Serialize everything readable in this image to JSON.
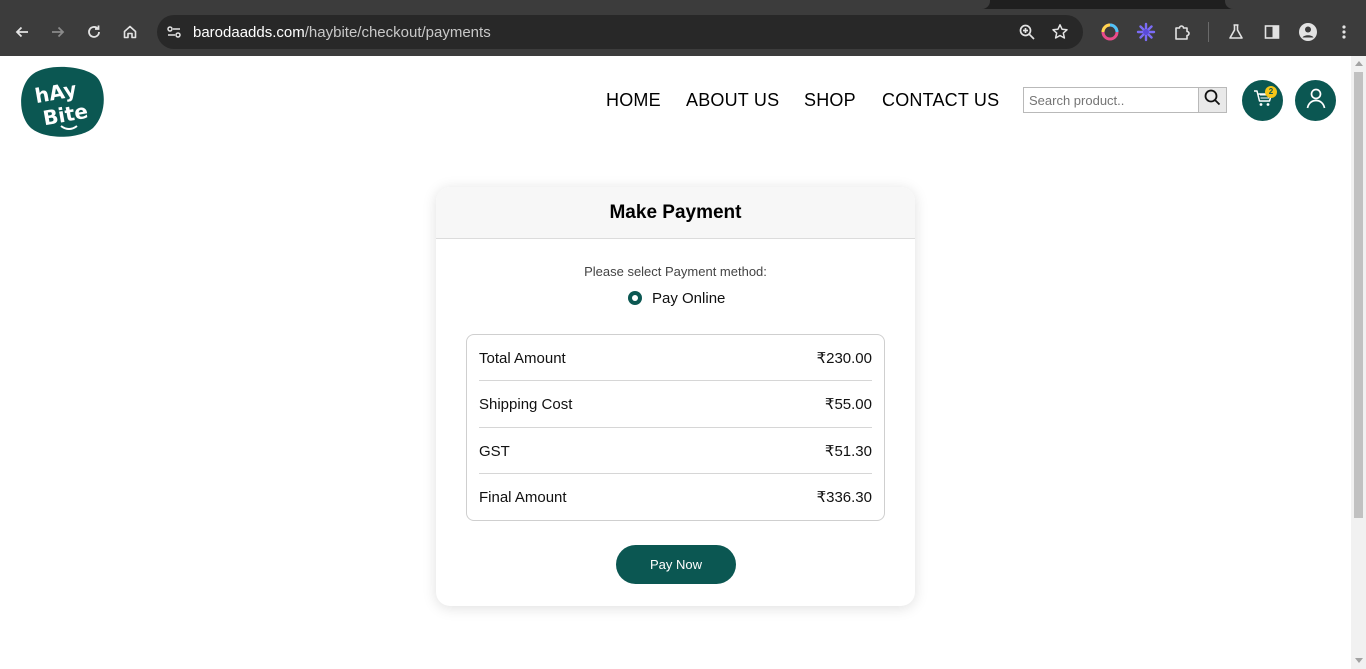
{
  "browser": {
    "url_host": "barodaadds.com",
    "url_path": "/haybite/checkout/payments",
    "icons": [
      "back-arrow-icon",
      "forward-arrow-icon",
      "reload-icon",
      "home-icon",
      "site-info-icon",
      "zoom-icon",
      "bookmark-star-icon",
      "color-extension-icon",
      "sparkle-extension-icon",
      "puzzle-extensions-icon",
      "labs-flask-icon",
      "side-panel-icon",
      "profile-icon",
      "menu-dots-icon"
    ]
  },
  "site": {
    "logo_alt": "hAy Bite",
    "nav": [
      "HOME",
      "ABOUT US",
      "SHOP",
      "CONTACT US"
    ],
    "search_placeholder": "Search product..",
    "cart_count": "2",
    "brand_color": "#0b5752",
    "badge_color": "#f5c518"
  },
  "payment": {
    "title": "Make Payment",
    "select_label": "Please select Payment method:",
    "method_label": "Pay Online",
    "rows": [
      {
        "label": "Total Amount",
        "value": "₹230.00"
      },
      {
        "label": "Shipping Cost",
        "value": "₹55.00"
      },
      {
        "label": "GST",
        "value": "₹51.30"
      },
      {
        "label": "Final Amount",
        "value": "₹336.30"
      }
    ],
    "pay_button": "Pay Now"
  }
}
